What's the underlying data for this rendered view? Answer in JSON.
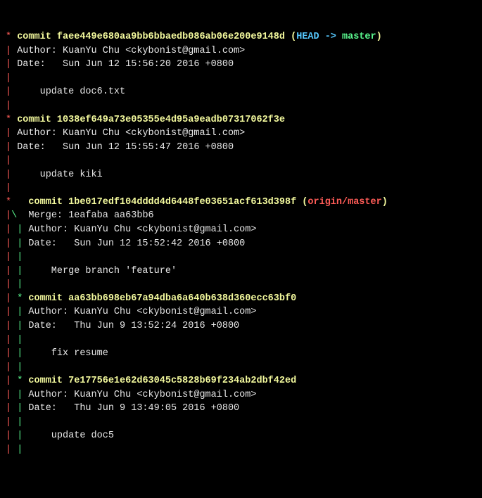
{
  "commits": [
    {
      "graph_star": "* ",
      "commit_word": "commit ",
      "hash": "faee449e680aa9bb6bbaedb086ab06e200e9148d",
      "refs_open": " (",
      "head": "HEAD -> ",
      "branch": "master",
      "refs_close": ")",
      "graph_pipe": "| ",
      "author_line": "Author: KuanYu Chu <ckybonist@gmail.com>",
      "date_line": "Date:   Sun Jun 12 15:56:20 2016 +0800",
      "msg_line": "    update doc6.txt"
    },
    {
      "graph_star": "* ",
      "commit_word": "commit ",
      "hash": "1038ef649a73e05355e4d95a9eadb07317062f3e",
      "graph_pipe": "| ",
      "author_line": "Author: KuanYu Chu <ckybonist@gmail.com>",
      "date_line": "Date:   Sun Jun 12 15:55:47 2016 +0800",
      "msg_line": "    update kiki"
    },
    {
      "graph_star": "*   ",
      "commit_word": "commit ",
      "hash": "1be017edf104dddd4d6448fe03651acf613d398f",
      "refs_open": " (",
      "refs_remote": "origin/master",
      "refs_close": ")",
      "graph_branch1": "|",
      "graph_branch2": "\\  ",
      "merge_line": "Merge: 1eafaba aa63bb6",
      "p1": "| ",
      "p2": "| ",
      "author_line": "Author: KuanYu Chu <ckybonist@gmail.com>",
      "date_line": "Date:   Sun Jun 12 15:52:42 2016 +0800",
      "msg_line": "    Merge branch 'feature'"
    },
    {
      "p1": "| ",
      "graph_star": "* ",
      "commit_word": "commit ",
      "hash": "aa63bb698eb67a94dba6a640b638d360ecc63bf0",
      "p2": "| ",
      "author_line": "Author: KuanYu Chu <ckybonist@gmail.com>",
      "date_line": "Date:   Thu Jun 9 13:52:24 2016 +0800",
      "msg_line": "    fix resume"
    },
    {
      "p1": "| ",
      "graph_star": "* ",
      "commit_word": "commit ",
      "hash": "7e17756e1e62d63045c5828b69f234ab2dbf42ed",
      "p2": "| ",
      "author_line": "Author: KuanYu Chu <ckybonist@gmail.com>",
      "date_line": "Date:   Thu Jun 9 13:49:05 2016 +0800",
      "msg_line": "    update doc5"
    }
  ]
}
